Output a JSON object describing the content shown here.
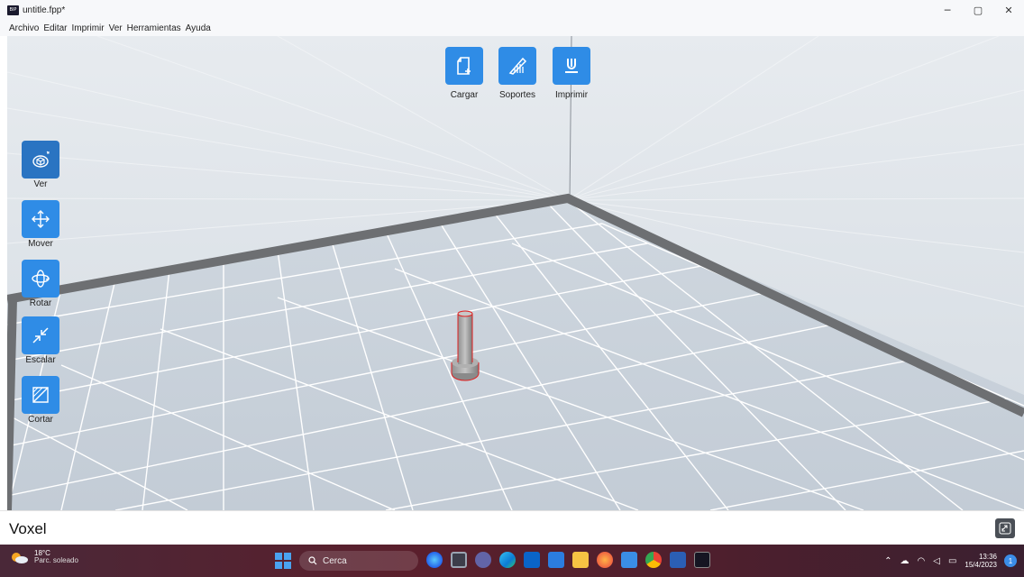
{
  "window": {
    "title": "untitle.fpp*",
    "app_icon_text": "BIP",
    "minimize_glyph": "─",
    "maximize_glyph": "▢",
    "close_glyph": "✕"
  },
  "menu": {
    "items": [
      "Archivo",
      "Editar",
      "Imprimir",
      "Ver",
      "Herramientas",
      "Ayuda"
    ]
  },
  "top_toolbar": {
    "items": [
      {
        "label": "Cargar",
        "icon": "load-file-icon"
      },
      {
        "label": "Soportes",
        "icon": "supports-icon"
      },
      {
        "label": "Imprimir",
        "icon": "print-icon"
      }
    ]
  },
  "left_toolbar": {
    "items": [
      {
        "label": "Ver",
        "icon": "view-cube-icon",
        "active": true
      },
      {
        "label": "Mover",
        "icon": "move-arrows-icon"
      },
      {
        "label": "Rotar",
        "icon": "rotate-icon"
      },
      {
        "label": "Escalar",
        "icon": "scale-icon"
      },
      {
        "label": "Cortar",
        "icon": "cut-icon"
      }
    ]
  },
  "status": {
    "text": "Voxel",
    "icon": "link-icon"
  },
  "taskbar": {
    "weather_temp": "18°C",
    "weather_desc": "Parc. soleado",
    "search_placeholder": "Cerca",
    "apps": [
      "copilot-icon",
      "task-view-icon",
      "teams-chat-icon",
      "edge-icon",
      "mail-icon",
      "store-icon",
      "file-explorer-icon",
      "browser-icon",
      "calendar-icon",
      "chrome-icon",
      "word-icon",
      "bip-app-icon"
    ],
    "clock_time": "13:36",
    "clock_date": "15/4/2023",
    "notification_count": "1"
  },
  "colors": {
    "accent": "#2f8ce6",
    "accent_active": "#2a74c2",
    "viewport_bg": "#dde3e9",
    "model_outline": "#e02020"
  }
}
